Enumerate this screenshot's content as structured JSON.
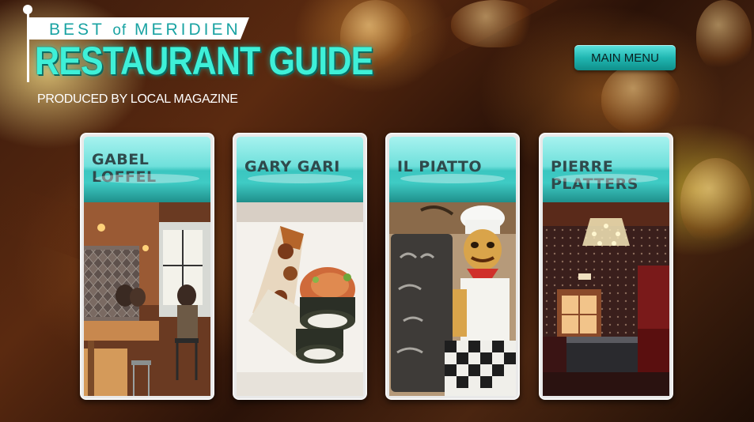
{
  "header": {
    "banner_pre": "BEST",
    "banner_of": "of",
    "banner_post": "MERIDIEN",
    "title": "RESTAURANT GUIDE",
    "subtitle": "PRODUCED BY LOCAL MAGAZINE"
  },
  "nav": {
    "main_menu_label": "MAIN MENU"
  },
  "restaurants": [
    {
      "name": "GABEL LOFFEL"
    },
    {
      "name": "GARY GARI"
    },
    {
      "name": "IL PIATTO"
    },
    {
      "name": "PIERRE PLATTERS"
    }
  ],
  "colors": {
    "accent": "#3ef0d8",
    "teal_button": "#21b7b2",
    "card_title": "#2f4a4c"
  }
}
